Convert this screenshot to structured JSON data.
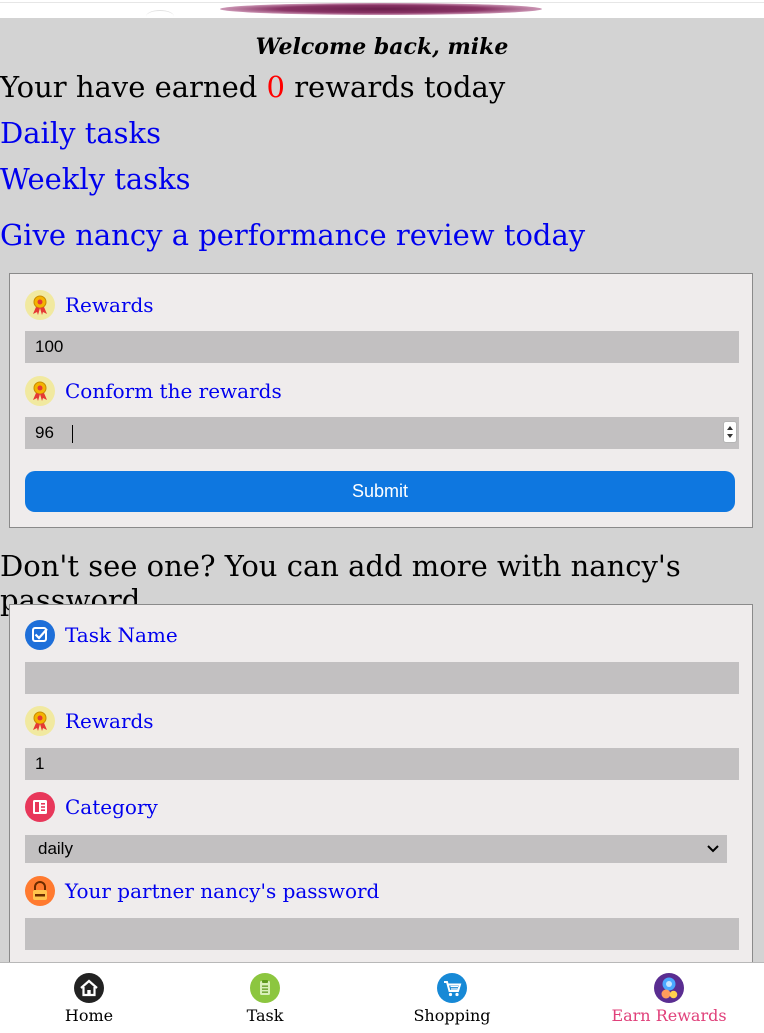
{
  "header": {
    "welcome": "Welcome back, mike"
  },
  "summary": {
    "prefix": "Your have earned",
    "count": "0",
    "suffix": "rewards today"
  },
  "links": {
    "daily": "Daily tasks",
    "weekly": "Weekly tasks",
    "review": "Give nancy a performance review today"
  },
  "review_form": {
    "rewards_label": "Rewards",
    "rewards_value": "100",
    "confirm_label": "Conform the rewards",
    "confirm_value": "96",
    "submit_label": "Submit"
  },
  "add_prompt": "Don't see one? You can add more with nancy's password",
  "add_form": {
    "task_name_label": "Task Name",
    "task_name_value": "",
    "rewards_label": "Rewards",
    "rewards_value": "1",
    "category_label": "Category",
    "category_value": "daily",
    "password_label": "Your partner nancy's password",
    "password_value": ""
  },
  "tabbar": {
    "items": [
      {
        "label": "Home",
        "icon": "home-icon"
      },
      {
        "label": "Task",
        "icon": "task-icon"
      },
      {
        "label": "Shopping",
        "icon": "shopping-cart-icon"
      },
      {
        "label": "Earn Rewards",
        "icon": "earn-rewards-icon",
        "active": true
      }
    ]
  },
  "colors": {
    "background": "#d3d3d3",
    "link": "#0000ee",
    "count": "#ff0000",
    "submit": "#0e77e0",
    "active_tab": "#e0407a"
  }
}
